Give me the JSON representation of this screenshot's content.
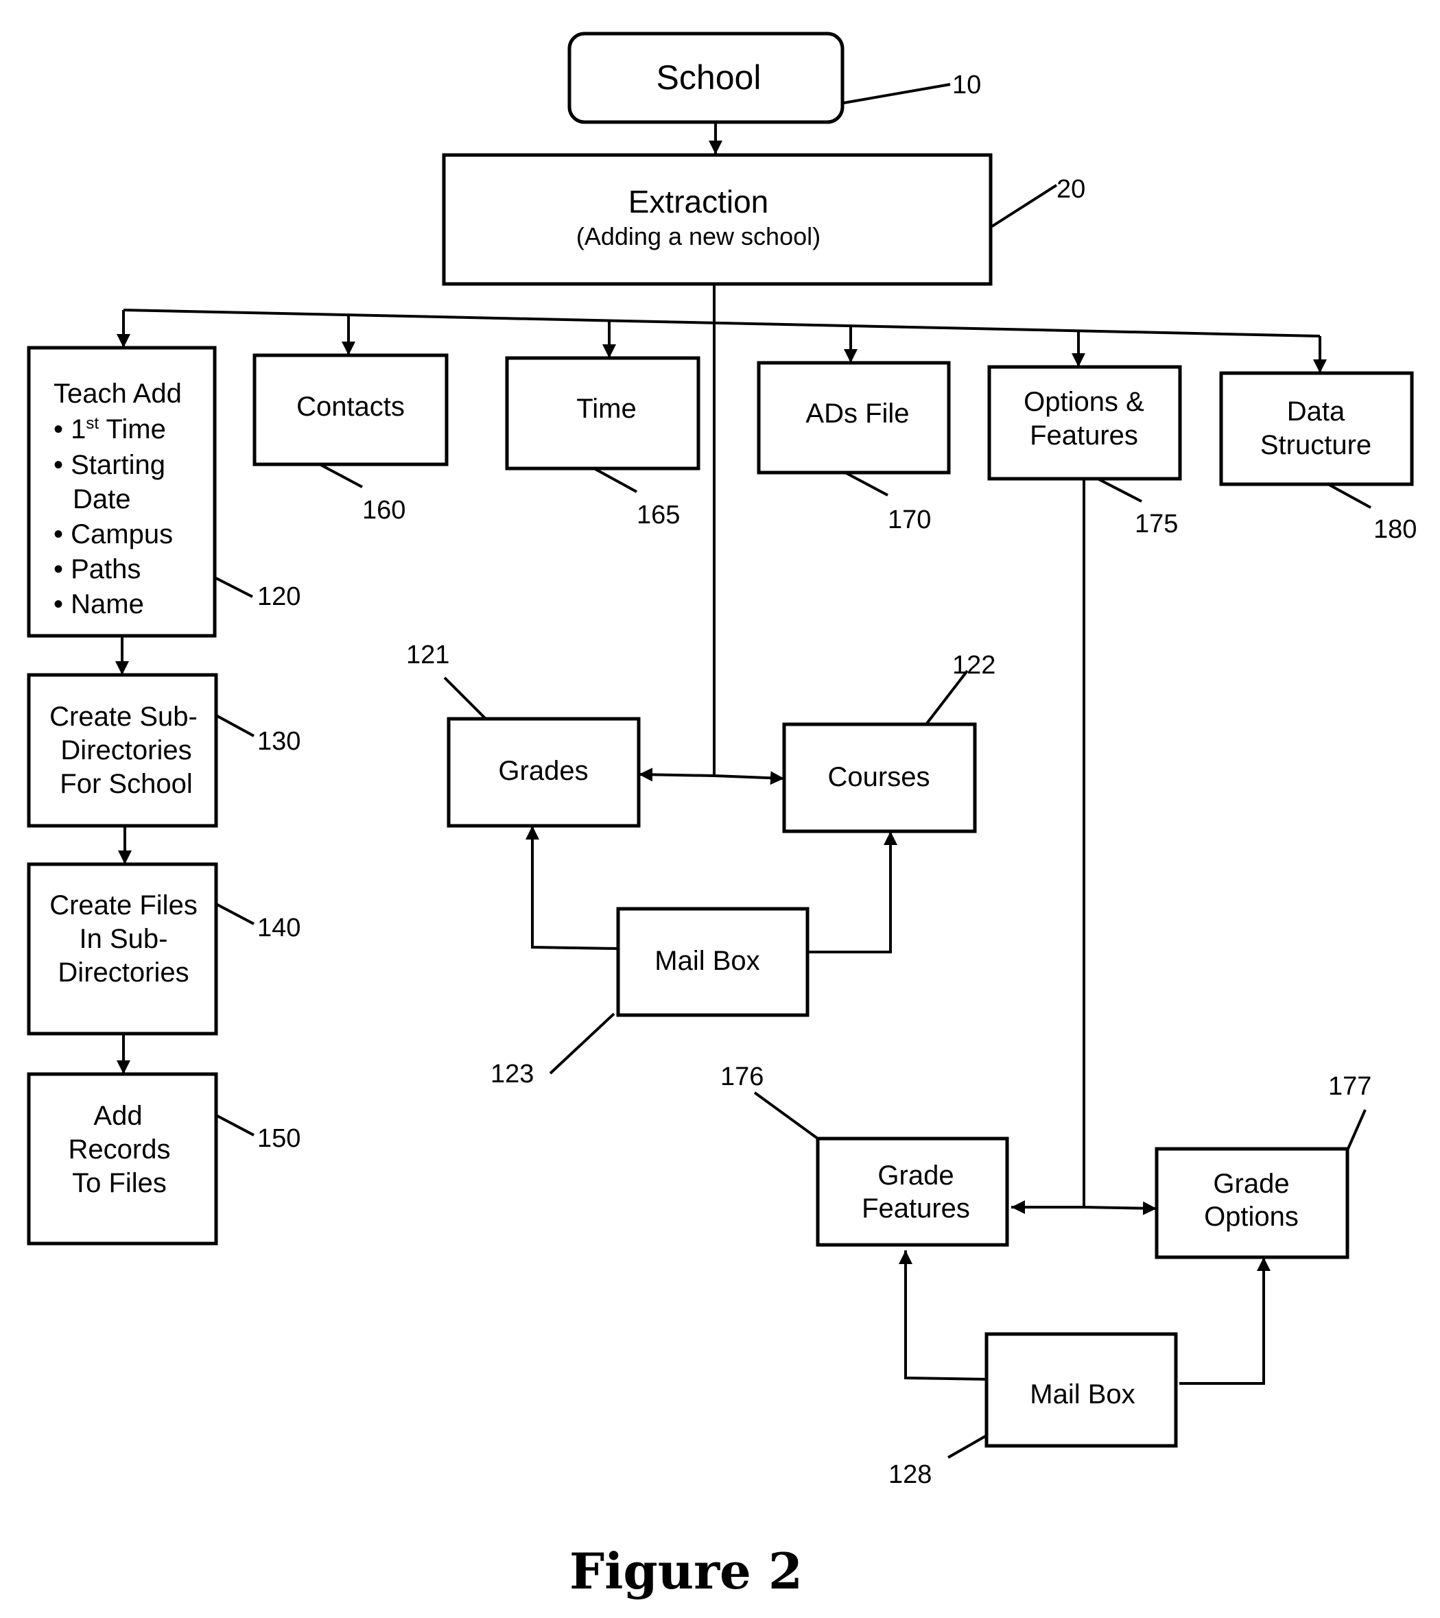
{
  "figure": {
    "caption": "Figure 2",
    "background": "#ffffff",
    "ink": "#000000"
  },
  "nodes": {
    "school": {
      "ref": "10",
      "lines": [
        "School"
      ]
    },
    "extraction": {
      "ref": "20",
      "lines": [
        "Extraction",
        "(Adding a new school)"
      ]
    },
    "teach_add": {
      "ref": "120",
      "title": "Teach Add",
      "bullets": [
        {
          "text": "1",
          "sup": "st",
          "rest": " Time"
        },
        {
          "text": "Starting",
          "cont": "Date"
        },
        {
          "text": "Campus"
        },
        {
          "text": "Paths"
        },
        {
          "text": "Name"
        }
      ]
    },
    "create_subdirs": {
      "ref": "130",
      "lines": [
        "Create Sub-",
        "Directories",
        "For School"
      ]
    },
    "create_files": {
      "ref": "140",
      "lines": [
        "Create Files",
        "In Sub-",
        "Directories"
      ]
    },
    "add_records": {
      "ref": "150",
      "lines": [
        "Add",
        "Records",
        "To Files"
      ]
    },
    "contacts": {
      "ref": "160",
      "lines": [
        "Contacts"
      ]
    },
    "time": {
      "ref": "165",
      "lines": [
        "Time"
      ]
    },
    "ads_file": {
      "ref": "170",
      "lines": [
        "ADs File"
      ]
    },
    "options_features": {
      "ref": "175",
      "lines": [
        "Options &",
        "Features"
      ]
    },
    "data_structure": {
      "ref": "180",
      "lines": [
        "Data",
        "Structure"
      ]
    },
    "grades": {
      "ref": "121",
      "lines": [
        "Grades"
      ]
    },
    "courses": {
      "ref": "122",
      "lines": [
        "Courses"
      ]
    },
    "mailbox_a": {
      "ref": "123",
      "lines": [
        "Mail Box"
      ]
    },
    "grade_features": {
      "ref": "176",
      "lines": [
        "Grade",
        "Features"
      ]
    },
    "grade_options": {
      "ref": "177",
      "lines": [
        "Grade",
        "Options"
      ]
    },
    "mailbox_b": {
      "ref": "128",
      "lines": [
        "Mail Box"
      ]
    }
  },
  "edges": [
    {
      "from": "school",
      "to": "extraction"
    },
    {
      "from": "extraction",
      "to": "teach_add"
    },
    {
      "from": "extraction",
      "to": "contacts"
    },
    {
      "from": "extraction",
      "to": "time"
    },
    {
      "from": "extraction",
      "to": "ads_file"
    },
    {
      "from": "extraction",
      "to": "options_features"
    },
    {
      "from": "extraction",
      "to": "data_structure"
    },
    {
      "from": "extraction",
      "to": "grades"
    },
    {
      "from": "extraction",
      "to": "courses"
    },
    {
      "from": "teach_add",
      "to": "create_subdirs"
    },
    {
      "from": "create_subdirs",
      "to": "create_files"
    },
    {
      "from": "create_files",
      "to": "add_records"
    },
    {
      "from": "mailbox_a",
      "to": "grades"
    },
    {
      "from": "mailbox_a",
      "to": "courses"
    },
    {
      "from": "options_features",
      "to": "grade_features"
    },
    {
      "from": "options_features",
      "to": "grade_options"
    },
    {
      "from": "mailbox_b",
      "to": "grade_features"
    },
    {
      "from": "mailbox_b",
      "to": "grade_options"
    }
  ]
}
